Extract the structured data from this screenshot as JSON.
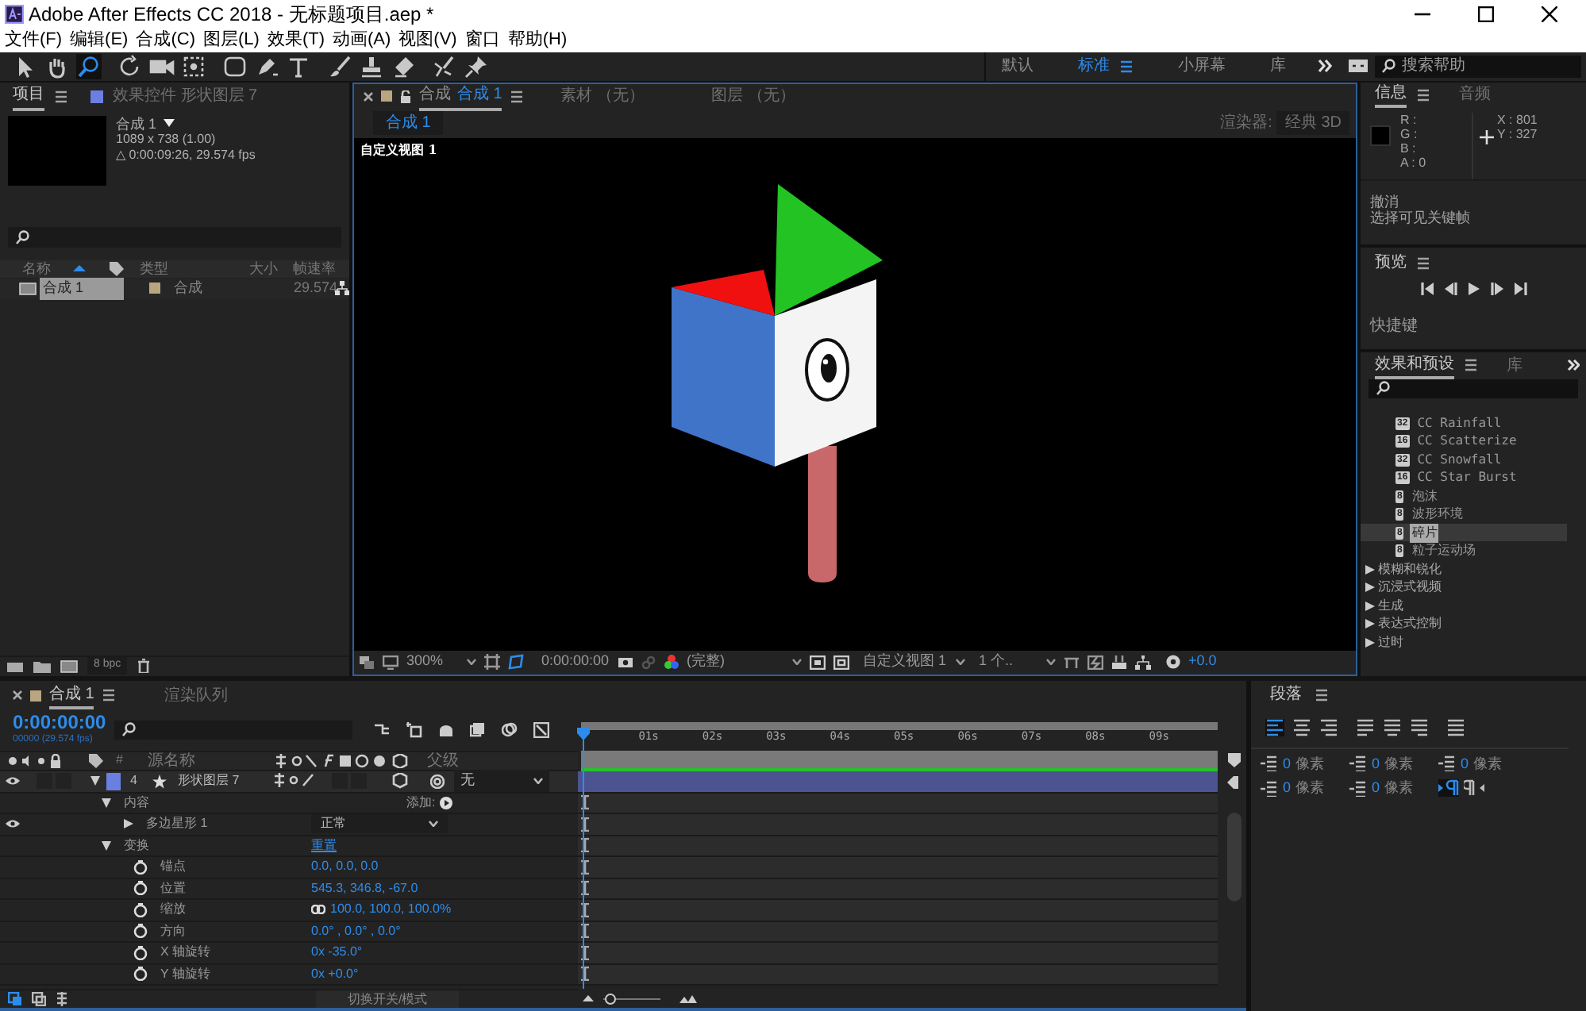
{
  "window": {
    "title": "Adobe After Effects CC 2018 - 无标题项目.aep *"
  },
  "menu": [
    "文件(F)",
    "编辑(E)",
    "合成(C)",
    "图层(L)",
    "效果(T)",
    "动画(A)",
    "视图(V)",
    "窗口",
    "帮助(H)"
  ],
  "tools": [
    {
      "kind": "select",
      "selected": false
    },
    {
      "kind": "hand",
      "selected": false
    },
    {
      "kind": "zoom",
      "selected": true
    },
    {
      "kind": "rotate",
      "selected": false
    },
    {
      "kind": "camera",
      "selected": false
    },
    {
      "kind": "panbehind",
      "selected": false
    },
    {
      "kind": "rect",
      "selected": false
    },
    {
      "kind": "pen",
      "selected": false
    },
    {
      "kind": "text",
      "selected": false
    },
    {
      "kind": "brush",
      "selected": false
    },
    {
      "kind": "stamp",
      "selected": false
    },
    {
      "kind": "eraser",
      "selected": false
    },
    {
      "kind": "roto",
      "selected": false
    },
    {
      "kind": "puppet",
      "selected": false
    }
  ],
  "workspaces": [
    {
      "label": "默认",
      "selected": false
    },
    {
      "label": "标准",
      "selected": true
    },
    {
      "label": "小屏幕",
      "selected": false
    },
    {
      "label": "库",
      "selected": false
    }
  ],
  "help_search": {
    "placeholder": "搜索帮助"
  },
  "project_panel": {
    "tabs": [
      {
        "label": "项目",
        "selected": true
      },
      {
        "label": "效果控件 形状图层 7",
        "selected": false
      }
    ],
    "comp": {
      "name": "合成 1",
      "size": "1089 x 738 (1.00)",
      "duration": "△ 0:00:09:26, 29.574 fps"
    },
    "columns": [
      "名称",
      "类型",
      "大小",
      "帧速率"
    ],
    "rows": [
      {
        "name": "合成 1",
        "type": "合成",
        "fps": "29.574",
        "selected": true
      }
    ],
    "bit_depth": "8 bpc"
  },
  "viewer": {
    "tabs": [
      {
        "prefix": "合成",
        "label": "合成 1",
        "selected": true
      },
      {
        "label": "素材 （无）",
        "selected": false
      },
      {
        "label": "图层 （无）",
        "selected": false
      }
    ],
    "breadcrumb": "合成 1",
    "renderer_label": "渲染器:",
    "renderer": "经典 3D",
    "view_label": "自定义视图 1",
    "zoom": "300%",
    "timecode": "0:00:00:00",
    "resolution": "(完整)",
    "view": "自定义视图 1",
    "view_count": "1 个..",
    "exposure": "+0.0"
  },
  "info_panel": {
    "tabs": [
      {
        "label": "信息",
        "selected": true
      },
      {
        "label": "音频",
        "selected": false
      }
    ],
    "channels": [
      "R :",
      "G :",
      "B :",
      "A : 0"
    ],
    "x": "X : 801",
    "y": "Y : 327",
    "history": [
      "撤消",
      "选择可见关键帧"
    ]
  },
  "preview_panel": {
    "title": "预览",
    "shortcut_label": "快捷键"
  },
  "effects_panel": {
    "tabs": [
      {
        "label": "效果和预设",
        "selected": true
      },
      {
        "label": "库",
        "selected": false
      }
    ],
    "items": [
      {
        "label": "CC Rainfall",
        "kind": "effect",
        "badge": "32",
        "selected": false
      },
      {
        "label": "CC Scatterize",
        "kind": "effect",
        "badge": "16",
        "selected": false
      },
      {
        "label": "CC Snowfall",
        "kind": "effect",
        "badge": "32",
        "selected": false
      },
      {
        "label": "CC Star Burst",
        "kind": "effect",
        "badge": "16",
        "selected": false
      },
      {
        "label": "泡沫",
        "kind": "effect",
        "badge": "8",
        "selected": false
      },
      {
        "label": "波形环境",
        "kind": "effect",
        "badge": "8",
        "selected": false
      },
      {
        "label": "碎片",
        "kind": "effect",
        "badge": "8",
        "selected": true
      },
      {
        "label": "粒子运动场",
        "kind": "effect",
        "badge": "8",
        "selected": false
      },
      {
        "label": "模糊和锐化",
        "kind": "category",
        "selected": false
      },
      {
        "label": "沉浸式视频",
        "kind": "category",
        "selected": false
      },
      {
        "label": "生成",
        "kind": "category",
        "selected": false
      },
      {
        "label": "表达式控制",
        "kind": "category",
        "selected": false
      },
      {
        "label": "过时",
        "kind": "category",
        "selected": false
      }
    ]
  },
  "timeline": {
    "tabs": [
      {
        "label": "合成 1",
        "selected": true
      },
      {
        "label": "渲染队列",
        "selected": false
      }
    ],
    "timecode": "0:00:00:00",
    "frame_info": "00000 (29.574 fps)",
    "columns": [
      "#",
      "源名称",
      "父级"
    ],
    "layer": {
      "index": "4",
      "name": "形状图层 7",
      "visible": true,
      "solo": false,
      "locked": false,
      "expanded": true,
      "parent": "无"
    },
    "zoom_slider": {
      "level": 0.05
    },
    "properties": [
      {
        "label": "内容",
        "expanded": true,
        "action": "添加:",
        "children": [
          {
            "label": "多边星形 1",
            "expanded": false,
            "visible": true,
            "mode": "正常"
          }
        ]
      },
      {
        "label": "变换",
        "expanded": true,
        "action": "重置",
        "children": [
          {
            "label": "锚点",
            "value": "0.0, 0.0, 0.0",
            "linked": false
          },
          {
            "label": "位置",
            "value": "545.3, 346.8, -67.0",
            "linked": false
          },
          {
            "label": "缩放",
            "value": "100.0, 100.0, 100.0%",
            "linked": true
          },
          {
            "label": "方向",
            "value": "0.0° , 0.0° , 0.0°",
            "linked": false
          },
          {
            "label": "X 轴旋转",
            "value": "0x -35.0°",
            "linked": false
          },
          {
            "label": "Y 轴旋转",
            "value": "0x +0.0°",
            "linked": false
          }
        ]
      }
    ],
    "ruler": [
      "01s",
      "02s",
      "03s",
      "04s",
      "05s",
      "06s",
      "07s",
      "08s",
      "09s"
    ],
    "toggle_label": "切换开关/模式"
  },
  "paragraph_panel": {
    "title": "段落",
    "alignments": [
      {
        "selected": true
      },
      {
        "selected": false
      },
      {
        "selected": false
      },
      {
        "selected": false
      },
      {
        "selected": false
      },
      {
        "selected": false
      },
      {
        "selected": false
      }
    ],
    "fields": [
      "0 像素",
      "0 像素",
      "0 像素",
      "0 像素",
      "0 像素"
    ],
    "directions": [
      {
        "selected": true
      },
      {
        "selected": false
      }
    ]
  }
}
